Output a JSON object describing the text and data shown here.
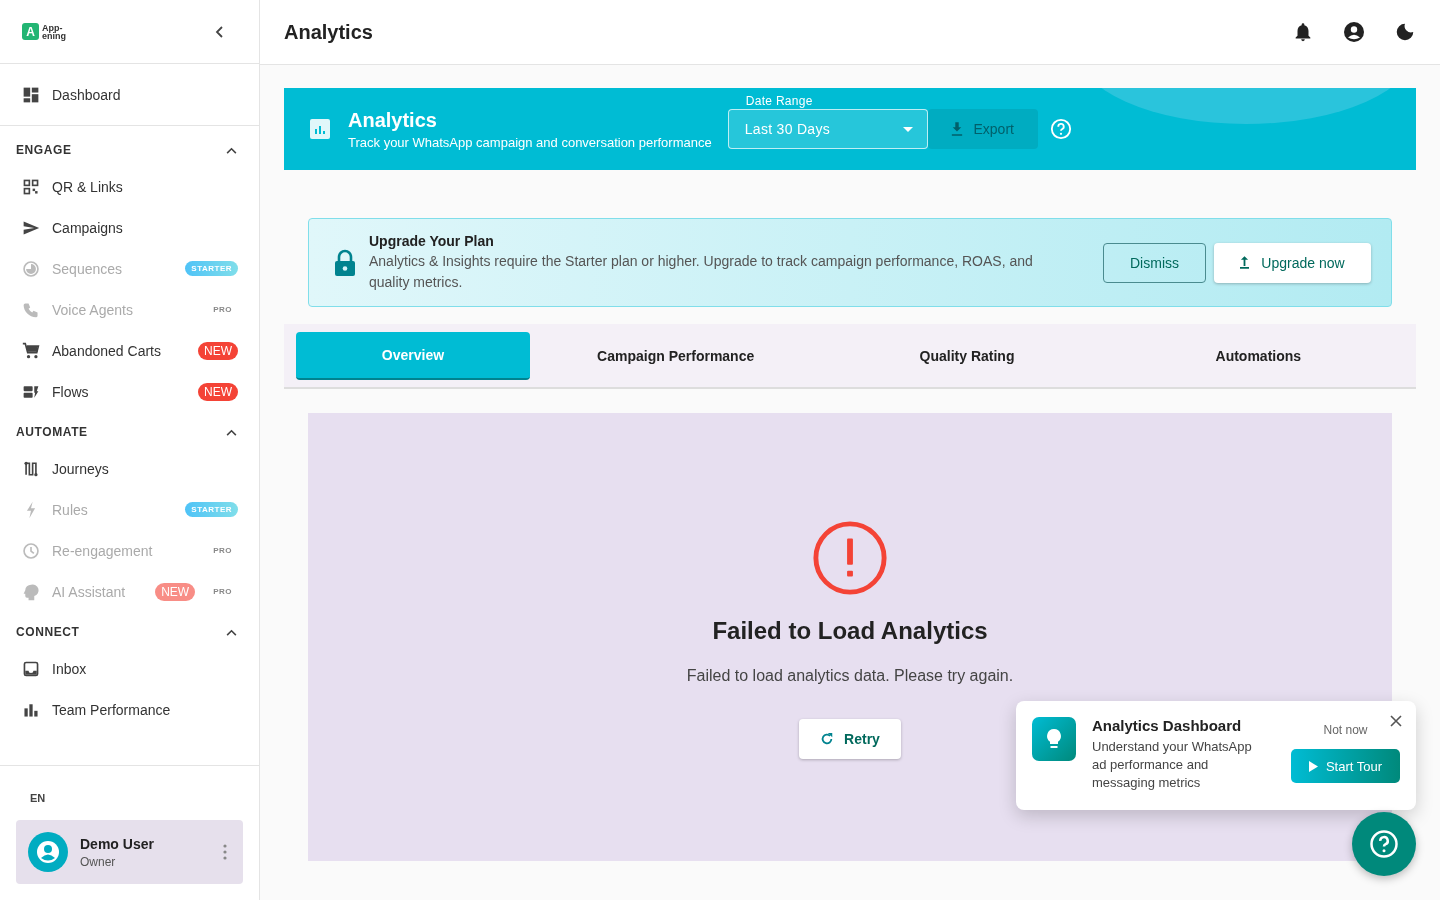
{
  "sidebar": {
    "logo_mark": "A",
    "logo_lines": [
      "App-",
      "ening"
    ],
    "top_items": [
      {
        "label": "Dashboard",
        "disabled": false
      }
    ],
    "sections": [
      {
        "title": "ENGAGE",
        "expanded": true,
        "items": [
          {
            "label": "QR & Links",
            "disabled": false
          },
          {
            "label": "Campaigns",
            "disabled": false
          },
          {
            "label": "Sequences",
            "disabled": true,
            "badges": [
              {
                "text": "STARTER",
                "kind": "starter"
              }
            ]
          },
          {
            "label": "Voice Agents",
            "disabled": true,
            "badges": [
              {
                "text": "PRO",
                "kind": "pro"
              }
            ]
          },
          {
            "label": "Abandoned Carts",
            "disabled": false,
            "badges": [
              {
                "text": "NEW",
                "kind": "new"
              }
            ]
          },
          {
            "label": "Flows",
            "disabled": false,
            "badges": [
              {
                "text": "NEW",
                "kind": "new"
              }
            ]
          }
        ]
      },
      {
        "title": "AUTOMATE",
        "expanded": true,
        "items": [
          {
            "label": "Journeys",
            "disabled": false
          },
          {
            "label": "Rules",
            "disabled": true,
            "badges": [
              {
                "text": "STARTER",
                "kind": "starter"
              }
            ]
          },
          {
            "label": "Re-engagement",
            "disabled": true,
            "badges": [
              {
                "text": "PRO",
                "kind": "pro"
              }
            ]
          },
          {
            "label": "AI Assistant",
            "disabled": true,
            "badges": [
              {
                "text": "NEW",
                "kind": "new"
              },
              {
                "text": "PRO",
                "kind": "pro"
              }
            ]
          }
        ]
      },
      {
        "title": "CONNECT",
        "expanded": true,
        "items": [
          {
            "label": "Inbox",
            "disabled": false
          },
          {
            "label": "Team Performance",
            "disabled": false
          }
        ]
      }
    ],
    "language": "EN",
    "user": {
      "name": "Demo User",
      "role": "Owner"
    }
  },
  "header": {
    "title": "Analytics"
  },
  "banner": {
    "title": "Analytics",
    "subtitle": "Track your WhatsApp campaign and conversation performance",
    "date_range": {
      "label": "Date Range",
      "value": "Last 30 Days"
    },
    "export": {
      "label": "Export",
      "disabled": true
    }
  },
  "upgrade_alert": {
    "title": "Upgrade Your Plan",
    "message": "Analytics & Insights require the Starter plan or higher. Upgrade to track campaign performance, ROAS, and quality metrics.",
    "buttons": [
      {
        "label": "Dismiss",
        "kind": "outline"
      },
      {
        "label": "Upgrade now",
        "kind": "raised"
      }
    ]
  },
  "tabs": [
    {
      "label": "Overview",
      "selected": true
    },
    {
      "label": "Campaign Performance",
      "selected": false
    },
    {
      "label": "Quality Rating",
      "selected": false
    },
    {
      "label": "Automations",
      "selected": false
    }
  ],
  "error": {
    "title": "Failed to Load Analytics",
    "message": "Failed to load analytics data. Please try again.",
    "button": "Retry"
  },
  "tour_popup": {
    "title": "Analytics Dashboard",
    "message": "Understand your WhatsApp ad performance and messaging metrics",
    "dismiss": "Not now",
    "action": "Start Tour"
  }
}
